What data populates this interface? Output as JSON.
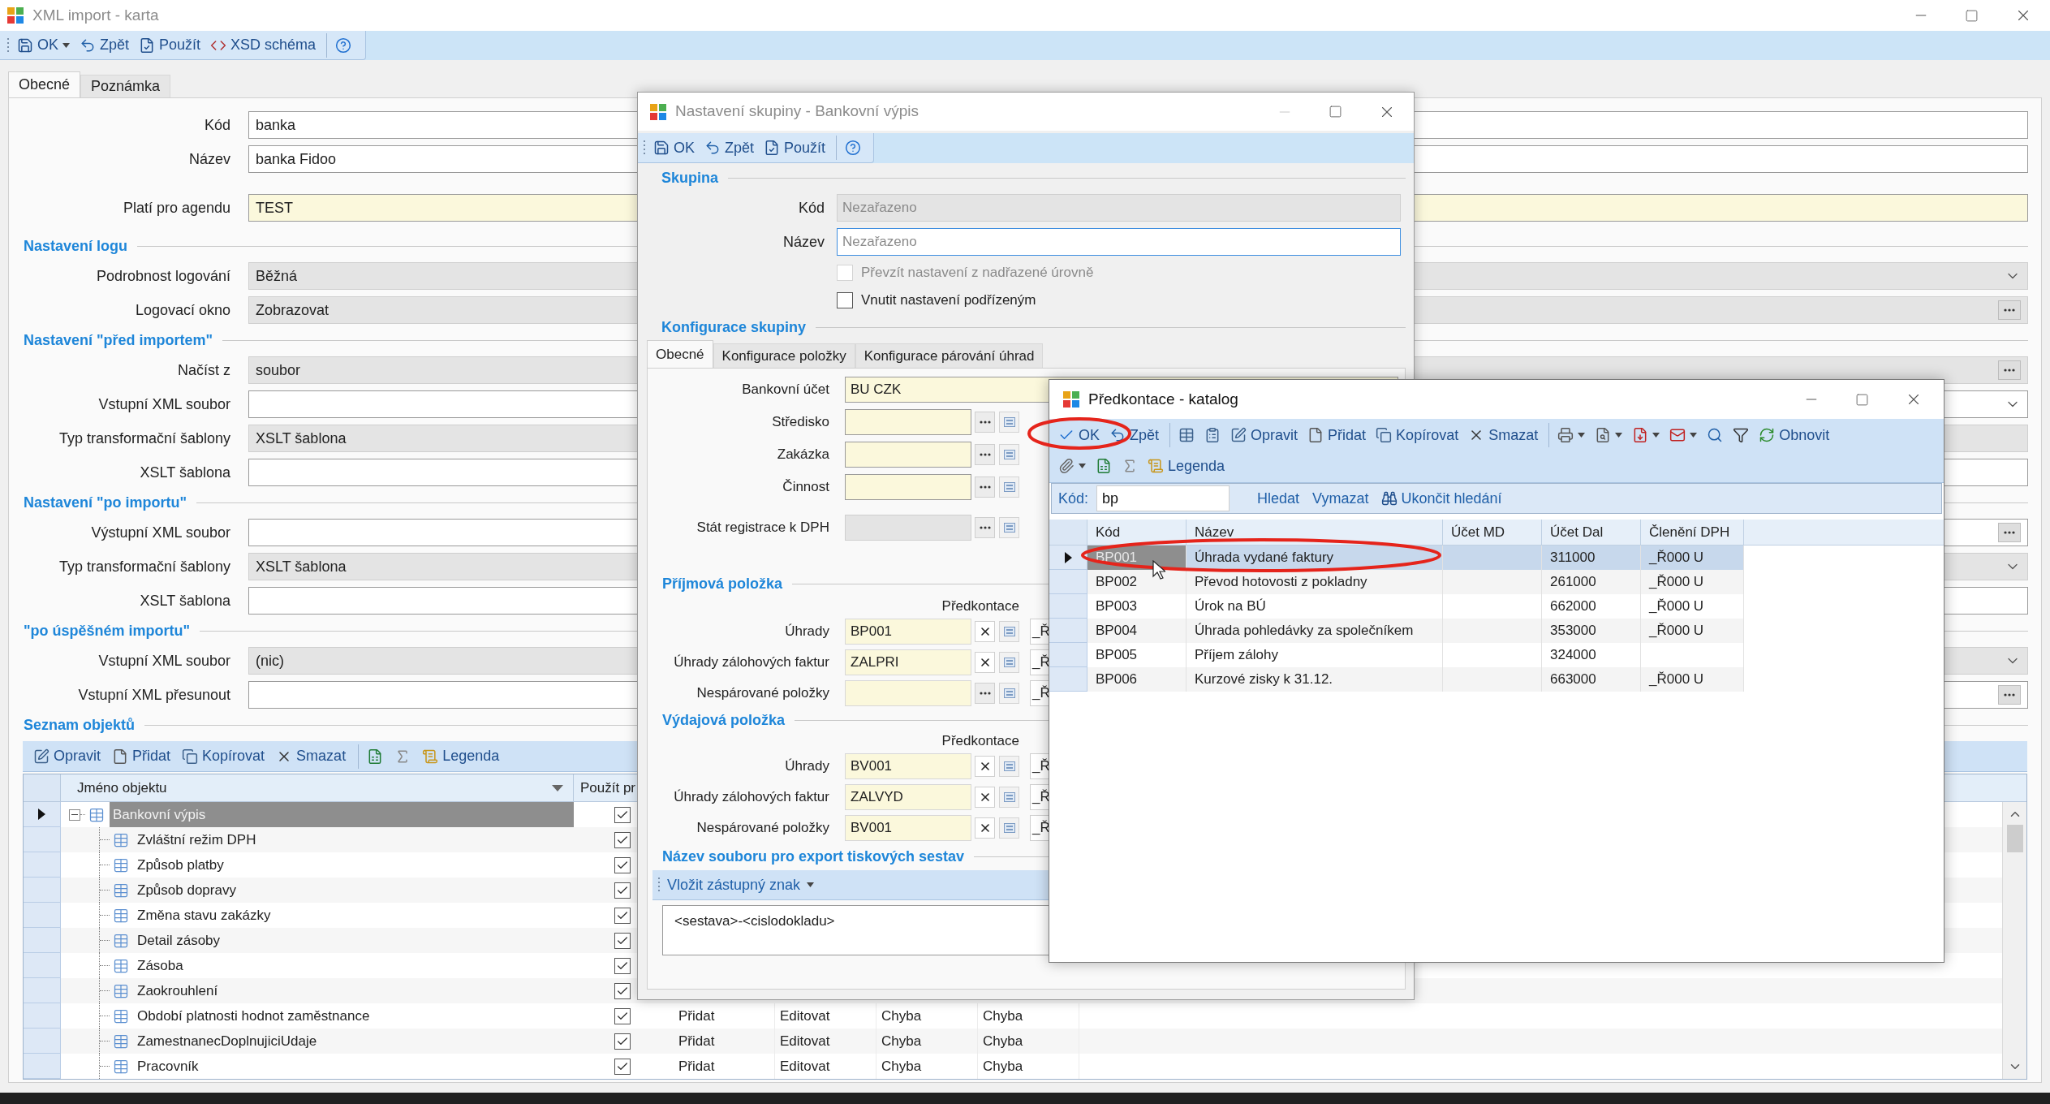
{
  "main_window": {
    "title": "XML import - karta",
    "toolbar": [
      {
        "label": "OK",
        "dropdown": true,
        "separator_before": false
      },
      {
        "label": "Zpět",
        "dropdown": false,
        "separator_before": false
      },
      {
        "label": "Použít",
        "dropdown": false,
        "separator_before": false
      },
      {
        "label": "XSD schéma",
        "dropdown": false,
        "separator_before": false
      },
      {
        "dropdown": false,
        "separator_before": true
      }
    ],
    "tabs": [
      {
        "label": "Obecné",
        "selected": true
      },
      {
        "label": "Poznámka",
        "selected": false
      }
    ],
    "header_fields": [
      {
        "label": "Kód",
        "value": "banka",
        "readonly": false,
        "required": false
      },
      {
        "label": "Název",
        "value": "banka Fidoo",
        "readonly": false,
        "required": false
      }
    ],
    "agenda_field": {
      "label": "Platí pro agendu",
      "value": "TEST",
      "readonly": false,
      "required": true
    },
    "sections": [
      {
        "title": "Nastavení logu",
        "fields": [
          {
            "label": "Podrobnost logování",
            "value": "Běžná",
            "kind": "combo",
            "readonly": true,
            "required": false
          },
          {
            "label": "Logovací okno",
            "value": "Zobrazovat",
            "kind": "browse",
            "readonly": true,
            "required": false
          }
        ]
      },
      {
        "title": "Nastavení \"před importem\"",
        "fields": [
          {
            "label": "Načíst z",
            "value": "soubor",
            "kind": "browse",
            "readonly": true,
            "required": false
          },
          {
            "label": "Vstupní XML soubor",
            "kind": "combo",
            "readonly": false,
            "required": false
          },
          {
            "label": "Typ transformační šablony",
            "value": "XSLT šablona",
            "kind": "text",
            "readonly": true,
            "required": false
          },
          {
            "label": "XSLT šablona",
            "kind": "text",
            "readonly": false,
            "required": false
          }
        ]
      },
      {
        "title": "Nastavení \"po importu\"",
        "fields": [
          {
            "label": "Výstupní XML soubor",
            "kind": "browse",
            "readonly": false,
            "required": false
          },
          {
            "label": "Typ transformační šablony",
            "value": "XSLT šablona",
            "kind": "combo",
            "readonly": true,
            "required": false
          },
          {
            "label": "XSLT šablona",
            "kind": "text",
            "readonly": false,
            "required": false
          }
        ]
      },
      {
        "title": "\"po úspěšném importu\"",
        "fields": [
          {
            "label": "Vstupní XML soubor",
            "value": "(nic)",
            "kind": "combo",
            "readonly": true,
            "required": false
          },
          {
            "label": "Vstupní XML přesunout",
            "kind": "browse",
            "readonly": false,
            "required": false
          }
        ]
      }
    ],
    "objects": {
      "title": "Seznam objektů",
      "toolbar": [
        {
          "label": "Opravit",
          "dropdown": false,
          "separator_before": false
        },
        {
          "label": "Přidat",
          "dropdown": false,
          "separator_before": false
        },
        {
          "label": "Kopírovat",
          "dropdown": false,
          "separator_before": false
        },
        {
          "label": "Smazat",
          "dropdown": false,
          "separator_before": false
        },
        {
          "dropdown": false,
          "separator_before": true
        },
        {
          "dropdown": false,
          "separator_before": false
        },
        {
          "label": "Legenda",
          "dropdown": false,
          "separator_before": false
        }
      ],
      "columns": [
        "Jméno objektu",
        "Použít pr"
      ],
      "tree": [
        {
          "label": "Bankovní výpis",
          "selected": true,
          "expanded": true,
          "checked": true,
          "children": [
            {
              "label": "Zvláštní režim DPH",
              "selected": false,
              "checked": true
            },
            {
              "label": "Způsob platby",
              "selected": false,
              "checked": true
            },
            {
              "label": "Způsob dopravy",
              "selected": false,
              "checked": true
            },
            {
              "label": "Změna stavu zakázky",
              "selected": false,
              "checked": true
            },
            {
              "label": "Detail zásoby",
              "selected": false,
              "checked": true
            },
            {
              "label": "Zásoba",
              "selected": false,
              "checked": true
            },
            {
              "label": "Zaokrouhlení",
              "selected": false,
              "checked": true
            },
            {
              "label": "Období platnosti hodnot zaměstnance",
              "selected": false,
              "checked": true,
              "cells": [
                "Přidat",
                "Editovat",
                "Chyba",
                "Chyba"
              ]
            },
            {
              "label": "ZamestnanecDoplnujiciUdaje",
              "selected": false,
              "checked": true,
              "cells": [
                "Přidat",
                "Editovat",
                "Chyba",
                "Chyba"
              ]
            },
            {
              "label": "Pracovník",
              "selected": false,
              "checked": true,
              "cells": [
                "Přidat",
                "Editovat",
                "Chyba",
                "Chyba"
              ]
            }
          ]
        }
      ]
    }
  },
  "group_dialog": {
    "title": "Nastavení skupiny - Bankovní výpis",
    "toolbar": [
      {
        "label": "OK",
        "dropdown": false,
        "separator_before": false
      },
      {
        "label": "Zpět",
        "dropdown": false,
        "separator_before": false
      },
      {
        "label": "Použít",
        "dropdown": false,
        "separator_before": false
      },
      {
        "dropdown": false,
        "separator_before": true
      }
    ],
    "group_section": {
      "title": "Skupina",
      "fields": [
        {
          "label": "Kód",
          "placeholder": "Nezařazeno",
          "readonly": true,
          "focused": false
        },
        {
          "label": "Název",
          "placeholder": "Nezařazeno",
          "readonly": false,
          "focused": true
        }
      ]
    },
    "checkboxes": [
      {
        "label": "Převzít nastavení z nadřazené úrovně",
        "checked": false,
        "disabled": true
      },
      {
        "label": "Vnutit nastavení podřízeným",
        "checked": false,
        "disabled": false
      }
    ],
    "config_title": "Konfigurace skupiny",
    "tabs": [
      {
        "label": "Obecné",
        "selected": true
      },
      {
        "label": "Konfigurace položky",
        "selected": false
      },
      {
        "label": "Konfigurace párování úhrad",
        "selected": false
      }
    ],
    "general_fields": [
      {
        "label": "Bankovní účet",
        "value": "BU CZK",
        "kind": "text",
        "readonly": false,
        "required": true
      },
      {
        "label": "Středisko",
        "kind": "browse",
        "readonly": false,
        "required": true
      },
      {
        "label": "Zakázka",
        "kind": "browse",
        "readonly": false,
        "required": true
      },
      {
        "label": "Činnost",
        "kind": "browse",
        "readonly": false,
        "required": true
      },
      {
        "label": "Stát registrace k DPH",
        "kind": "browse",
        "readonly": true,
        "required": false
      }
    ],
    "groups": [
      {
        "title": "Příjmová položka",
        "column_heading": "Předkontace",
        "rows": [
          {
            "label": "Úhrady",
            "value": "BP001",
            "kind": "clear",
            "vat": "_Ř"
          },
          {
            "label": "Úhrady zálohových faktur",
            "value": "ZALPRI",
            "kind": "clear",
            "vat": "_Ř"
          },
          {
            "label": "Nespárované položky",
            "kind": "browse",
            "vat": "_Ř"
          }
        ]
      },
      {
        "title": "Výdajová položka",
        "column_heading": "Předkontace",
        "rows": [
          {
            "label": "Úhrady",
            "value": "BV001",
            "kind": "clear",
            "vat": "_Ř"
          },
          {
            "label": "Úhrady zálohových faktur",
            "value": "ZALVYD",
            "kind": "clear",
            "vat": "_Ř"
          },
          {
            "label": "Nespárované položky",
            "value": "BV001",
            "kind": "clear",
            "vat": "_Ř"
          }
        ]
      }
    ],
    "export": {
      "title": "Název souboru pro export tiskových sestav",
      "menu": "Vložit zástupný znak",
      "value": "<sestava>-<cislodokladu>"
    }
  },
  "catalog_window": {
    "title": "Předkontace - katalog",
    "toolbar_rows": [
      [
        {
          "label": "OK",
          "dropdown": false,
          "separator_before": false
        },
        {
          "label": "Zpět",
          "dropdown": false,
          "separator_before": false
        },
        {
          "dropdown": false,
          "separator_before": true
        },
        {
          "dropdown": false,
          "separator_before": false
        },
        {
          "label": "Opravit",
          "dropdown": false,
          "separator_before": false
        },
        {
          "label": "Přidat",
          "dropdown": false,
          "separator_before": false
        },
        {
          "label": "Kopírovat",
          "dropdown": false,
          "separator_before": false
        },
        {
          "label": "Smazat",
          "dropdown": false,
          "separator_before": false
        },
        {
          "dropdown": true,
          "separator_before": true
        },
        {
          "dropdown": true,
          "separator_before": false
        },
        {
          "dropdown": true,
          "separator_before": false
        },
        {
          "dropdown": true,
          "separator_before": false
        },
        {
          "dropdown": false,
          "separator_before": false
        },
        {
          "dropdown": false,
          "separator_before": false
        },
        {
          "label": "Obnovit",
          "dropdown": false,
          "separator_before": false
        }
      ],
      [
        {
          "dropdown": true,
          "separator_before": false
        },
        {
          "dropdown": false,
          "separator_before": false
        },
        {
          "dropdown": false,
          "separator_before": false
        },
        {
          "label": "Legenda",
          "dropdown": false,
          "separator_before": false
        }
      ]
    ],
    "search": {
      "label": "Kód:",
      "value": "bp",
      "actions": [
        "Hledat",
        "Vymazat",
        "Ukončit hledání"
      ]
    },
    "columns": [
      "Kód",
      "Název",
      "Účet MD",
      "Účet Dal",
      "Členění DPH"
    ],
    "rows": [
      {
        "selected": true,
        "code": "BP001",
        "name": "Úhrada vydané faktury",
        "credit": "311000",
        "vat": "_Ř000 U"
      },
      {
        "selected": false,
        "code": "BP002",
        "name": "Převod hotovosti z pokladny",
        "credit": "261000",
        "vat": "_Ř000 U"
      },
      {
        "selected": false,
        "code": "BP003",
        "name": "Úrok na BÚ",
        "credit": "662000",
        "vat": "_Ř000 U"
      },
      {
        "selected": false,
        "code": "BP004",
        "name": "Úhrada pohledávky za společníkem",
        "credit": "353000",
        "vat": "_Ř000 U"
      },
      {
        "selected": false,
        "code": "BP005",
        "name": "Příjem zálohy",
        "credit": "324000"
      },
      {
        "selected": false,
        "code": "BP006",
        "name": "Kurzové zisky k 31.12.",
        "credit": "663000",
        "vat": "_Ř000 U"
      }
    ]
  }
}
